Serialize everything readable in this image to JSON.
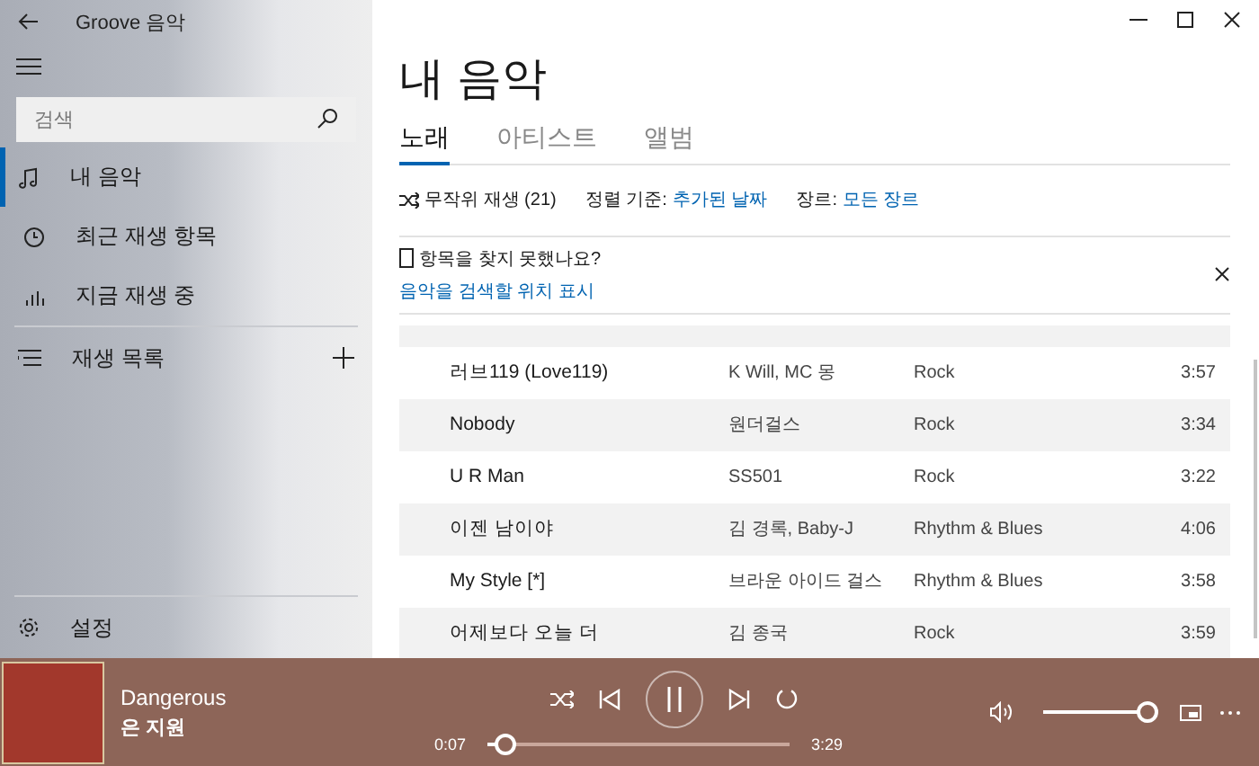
{
  "window": {
    "title": "Groove 음악"
  },
  "sidebar": {
    "search": {
      "placeholder": "검색"
    },
    "items": [
      {
        "kind": "music",
        "label": "내 음악",
        "selected": true
      },
      {
        "kind": "recent",
        "label": "최근 재생 항목",
        "selected": false
      },
      {
        "kind": "bars",
        "label": "지금 재생 중",
        "selected": false
      }
    ],
    "playlists": {
      "label": "재생 목록"
    },
    "settings": {
      "label": "설정"
    }
  },
  "main": {
    "title": "내 음악",
    "tabs": [
      {
        "label": "노래",
        "selected": true
      },
      {
        "label": "아티스트",
        "selected": false
      },
      {
        "label": "앨범",
        "selected": false
      }
    ],
    "toolbar": {
      "shuffle": "무작위 재생 (21)",
      "sort_label": "정렬 기준:",
      "sort_value": "추가된 날짜",
      "genre_label": "장르:",
      "genre_value": "모든 장르"
    },
    "notice": {
      "title": "항목을 찾지 못했나요?",
      "link": "음악을 검색할 위치 표시"
    },
    "songs": [
      {
        "title": "러브119 (Love119)",
        "artist": "K Will, MC 몽",
        "genre": "Rock",
        "duration": "3:57"
      },
      {
        "title": "Nobody",
        "artist": "원더걸스",
        "genre": "Rock",
        "duration": "3:34"
      },
      {
        "title": "U R Man",
        "artist": "SS501",
        "genre": "Rock",
        "duration": "3:22"
      },
      {
        "title": "이젠 남이야",
        "artist": "김 경록, Baby-J",
        "genre": "Rhythm & Blues",
        "duration": "4:06"
      },
      {
        "title": "My Style [*]",
        "artist": "브라운 아이드 걸스",
        "genre": "Rhythm & Blues",
        "duration": "3:58"
      },
      {
        "title": "어제보다 오늘 더",
        "artist": "김 종국",
        "genre": "Rock",
        "duration": "3:59"
      }
    ]
  },
  "player": {
    "title": "Dangerous",
    "artist": "은 지원",
    "elapsed": "0:07",
    "total": "3:29",
    "progress": {
      "level": 0.06
    },
    "volume": {
      "level": 1
    }
  }
}
